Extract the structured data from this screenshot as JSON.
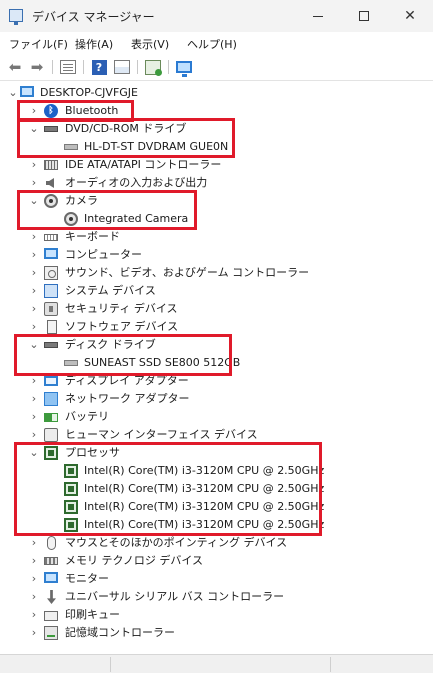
{
  "window": {
    "title": "デバイス マネージャー",
    "controls": {
      "minimize": "minimize-icon",
      "maximize": "maximize-icon",
      "close": "close-icon"
    }
  },
  "menu": [
    "ファイル(F)",
    "操作(A)",
    "表示(V)",
    "ヘルプ(H)"
  ],
  "toolbar": [
    "back-icon",
    "forward-icon",
    "properties-icon",
    "help-icon",
    "view-icon",
    "scan-hardware-icon",
    "monitor-icon"
  ],
  "tree": {
    "root": "DESKTOP-CJVFGJE",
    "categories": [
      {
        "label": "Bluetooth",
        "icon": "bluetooth-icon",
        "expanded": false
      },
      {
        "label": "DVD/CD-ROM ドライブ",
        "icon": "dvd-drive-icon",
        "expanded": true,
        "children": [
          "HL-DT-ST DVDRAM GUE0N"
        ]
      },
      {
        "label": "IDE ATA/ATAPI コントローラー",
        "icon": "ide-controller-icon",
        "expanded": false
      },
      {
        "label": "オーディオの入力および出力",
        "icon": "audio-icon",
        "expanded": false
      },
      {
        "label": "カメラ",
        "icon": "camera-icon",
        "expanded": true,
        "children": [
          "Integrated Camera"
        ]
      },
      {
        "label": "キーボード",
        "icon": "keyboard-icon",
        "expanded": false
      },
      {
        "label": "コンピューター",
        "icon": "computer-icon",
        "expanded": false
      },
      {
        "label": "サウンド、ビデオ、およびゲーム コントローラー",
        "icon": "sound-icon",
        "expanded": false
      },
      {
        "label": "システム デバイス",
        "icon": "system-device-icon",
        "expanded": false
      },
      {
        "label": "セキュリティ デバイス",
        "icon": "security-device-icon",
        "expanded": false
      },
      {
        "label": "ソフトウェア デバイス",
        "icon": "software-device-icon",
        "expanded": false
      },
      {
        "label": "ディスク ドライブ",
        "icon": "disk-drive-icon",
        "expanded": true,
        "children": [
          "SUNEAST SSD SE800 512GB"
        ]
      },
      {
        "label": "ディスプレイ アダプター",
        "icon": "display-adapter-icon",
        "expanded": false
      },
      {
        "label": "ネットワーク アダプター",
        "icon": "network-adapter-icon",
        "expanded": false
      },
      {
        "label": "バッテリ",
        "icon": "battery-icon",
        "expanded": false
      },
      {
        "label": "ヒューマン インターフェイス デバイス",
        "icon": "hid-icon",
        "expanded": false
      },
      {
        "label": "プロセッサ",
        "icon": "processor-icon",
        "expanded": true,
        "children": [
          "Intel(R) Core(TM) i3-3120M CPU @ 2.50GHz",
          "Intel(R) Core(TM) i3-3120M CPU @ 2.50GHz",
          "Intel(R) Core(TM) i3-3120M CPU @ 2.50GHz",
          "Intel(R) Core(TM) i3-3120M CPU @ 2.50GHz"
        ]
      },
      {
        "label": "マウスとそのほかのポインティング デバイス",
        "icon": "mouse-icon",
        "expanded": false
      },
      {
        "label": "メモリ テクノロジ デバイス",
        "icon": "memory-icon",
        "expanded": false
      },
      {
        "label": "モニター",
        "icon": "monitor-icon",
        "expanded": false
      },
      {
        "label": "ユニバーサル シリアル バス コントローラー",
        "icon": "usb-icon",
        "expanded": false
      },
      {
        "label": "印刷キュー",
        "icon": "printer-icon",
        "expanded": false
      },
      {
        "label": "記憶域コントローラー",
        "icon": "storage-controller-icon",
        "expanded": false
      }
    ]
  },
  "highlight_color": "#e01a2a"
}
